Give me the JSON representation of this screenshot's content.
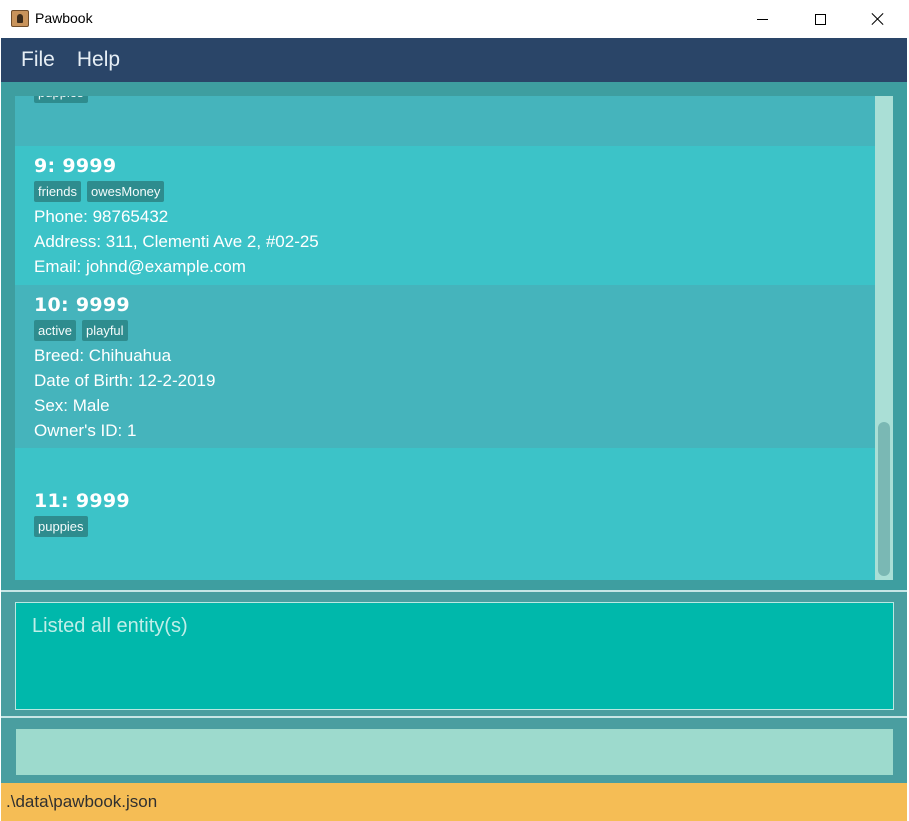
{
  "window": {
    "title": "Pawbook"
  },
  "menu": {
    "file": "File",
    "help": "Help"
  },
  "entities": [
    {
      "tags": [
        "puppies"
      ]
    },
    {
      "title": "9:  9999",
      "tags": [
        "friends",
        "owesMoney"
      ],
      "fields": [
        "Phone: 98765432",
        "Address: 311, Clementi Ave 2, #02-25",
        "Email: johnd@example.com"
      ]
    },
    {
      "title": "10:  9999",
      "tags": [
        "active",
        "playful"
      ],
      "fields": [
        "Breed: Chihuahua",
        "Date of Birth: 12-2-2019",
        "Sex: Male",
        "Owner's ID: 1"
      ]
    },
    {
      "title": "11:  9999",
      "tags": [
        "puppies"
      ]
    }
  ],
  "result": {
    "message": "Listed all entity(s)"
  },
  "command": {
    "value": "",
    "placeholder": ""
  },
  "status": {
    "file_path": ".\\data\\pawbook.json"
  },
  "colors": {
    "menubar": "#2a4568",
    "card_light": "#3cc3c8",
    "card_dark": "#45b4bc",
    "tag": "#2e8c8e",
    "result_bg": "#00b8ab",
    "command_bg": "#9ddacd",
    "statusbar": "#f5bd55"
  }
}
